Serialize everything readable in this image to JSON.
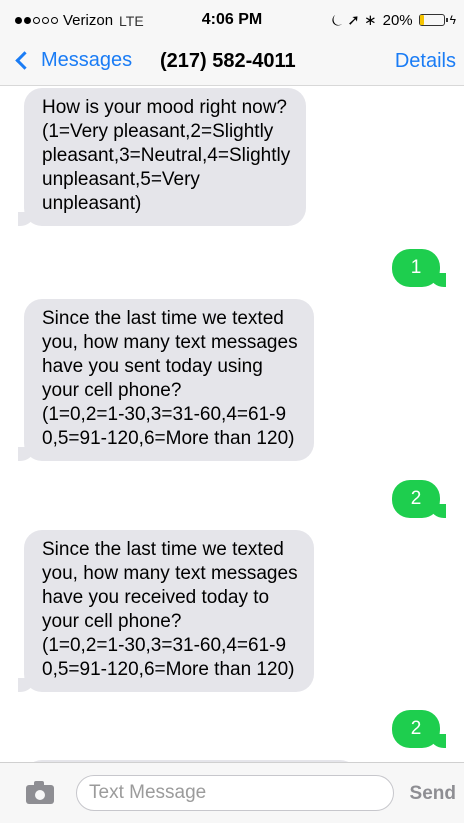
{
  "status_bar": {
    "carrier": "Verizon",
    "network": "LTE",
    "time": "4:06 PM",
    "icons": "⏾ ➚ ∗",
    "battery": "20%",
    "battery_fraction": 0.2,
    "battery_color": "#f5c400"
  },
  "nav": {
    "back_label": "Messages",
    "title": "(217) 582-4011",
    "details_label": "Details"
  },
  "messages": [
    {
      "direction": "incoming",
      "text": "How is your mood right now?\n(1=Very pleasant,2=Slightly\npleasant,3=Neutral,4=Slightly\nunpleasant,5=Very\nunpleasant)"
    },
    {
      "direction": "outgoing",
      "text": "1"
    },
    {
      "direction": "incoming",
      "text": "Since the last time we texted\nyou, how many text messages\nhave you sent today using\nyour cell phone?\n(1=0,2=1-30,3=31-60,4=61-9\n0,5=91-120,6=More than 120)"
    },
    {
      "direction": "outgoing",
      "text": "2"
    },
    {
      "direction": "incoming",
      "text": "Since the last time we texted\nyou, how many text messages\nhave you received today to\nyour cell phone?\n(1=0,2=1-30,3=31-60,4=61-9\n0,5=91-120,6=More than 120)"
    },
    {
      "direction": "outgoing",
      "text": "2"
    }
  ],
  "input": {
    "placeholder": "Text Message",
    "send_label": "Send"
  },
  "colors": {
    "accent": "#1a7cf5",
    "outgoing_bubble": "#1ece4e",
    "incoming_bubble": "#e5e5ea"
  }
}
